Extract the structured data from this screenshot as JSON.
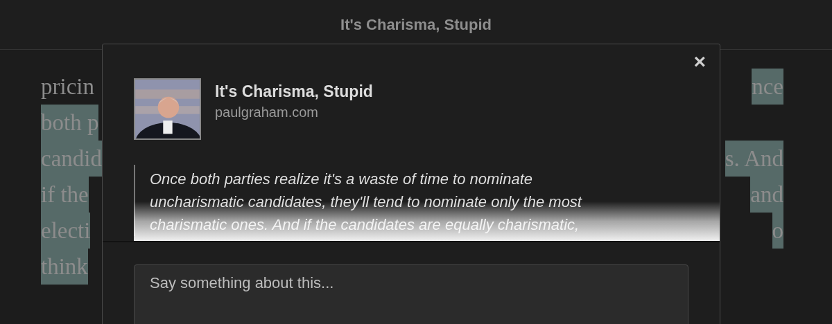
{
  "header": {
    "title": "It's Charisma, Stupid"
  },
  "article_lines": [
    {
      "left": {
        "text": "pricin",
        "highlighted": false
      },
      "right": {
        "text": "nce",
        "highlighted": true
      }
    },
    {
      "left": {
        "text": "both p",
        "highlighted": true
      }
    },
    {
      "left": {
        "text": "candid",
        "highlighted": true
      },
      "right": {
        "text": "s. And",
        "highlighted": true
      }
    },
    {
      "left": {
        "text": "if the",
        "highlighted": true
      },
      "right": {
        "text": "and",
        "highlighted": true
      }
    },
    {
      "left": {
        "text": "electi",
        "highlighted": true
      },
      "right": {
        "text": "o",
        "highlighted": true
      }
    },
    {
      "left": {
        "text": "think",
        "highlighted": true
      }
    }
  ],
  "share_dialog": {
    "close": "×",
    "title": "It's Charisma, Stupid",
    "domain": "paulgraham.com",
    "quote": "Once both parties realize it's a waste of time to nominate uncharismatic candidates, they'll tend to nominate only the most charismatic ones. And if the candidates are equally charismatic,",
    "comment": {
      "placeholder": "Say something about this..."
    }
  }
}
